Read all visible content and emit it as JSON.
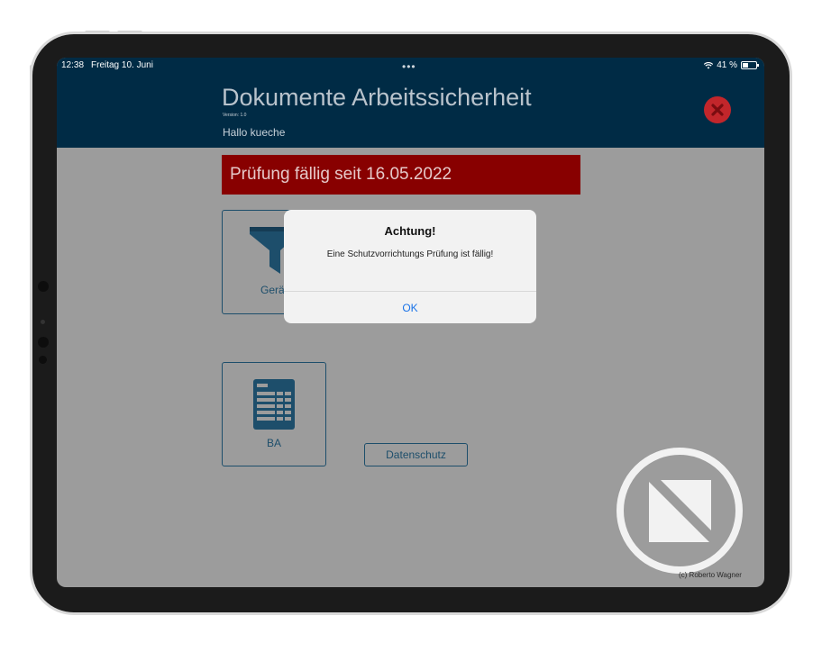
{
  "status_bar": {
    "time": "12:38",
    "date": "Freitag 10. Juni",
    "battery": "41 %"
  },
  "header": {
    "title": "Dokumente Arbeitssicherheit",
    "version": "Version: 1.0",
    "greeting": "Hallo kueche"
  },
  "banner": {
    "text": "Prüfung fällig seit 16.05.2022"
  },
  "tiles": [
    {
      "label": "Gerät"
    },
    {
      "label": "BA"
    }
  ],
  "datenschutz_label": "Datenschutz",
  "copyright": "(c) Roberto Wagner",
  "alert": {
    "title": "Achtung!",
    "message": "Eine Schutzvorrichtungs Prüfung ist fällig!",
    "ok_label": "OK"
  },
  "colors": {
    "header_bg": "#002b45",
    "banner_bg": "#880000",
    "screen_bg": "#9c9c9c",
    "accent": "#1d4e6b",
    "alert_button": "#1a73e8",
    "close_button": "#c2262b"
  },
  "icons": {
    "close": "close-circle-icon",
    "filter": "funnel-icon",
    "document": "document-table-icon",
    "watermark": "watermark-logo-icon",
    "wifi": "wifi-icon",
    "battery": "battery-icon"
  }
}
